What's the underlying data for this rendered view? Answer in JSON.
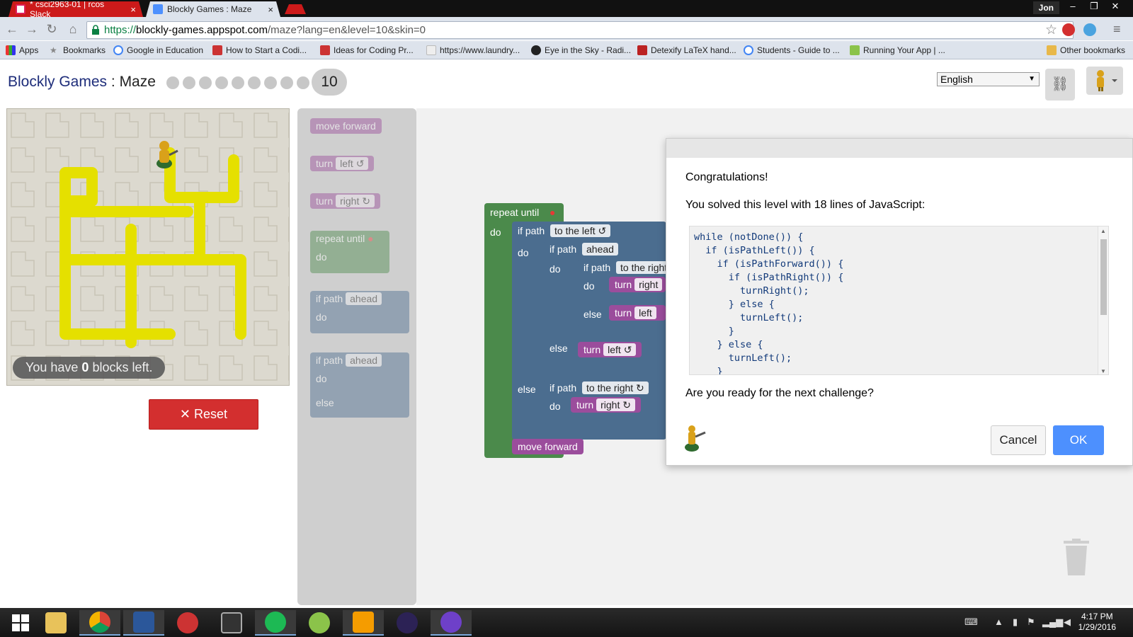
{
  "browser": {
    "tabs": [
      {
        "label": "* csci2963-01 | rcos Slack",
        "close": "×"
      },
      {
        "label": "Blockly Games : Maze",
        "close": "×"
      }
    ],
    "user": "Jon",
    "window_controls": {
      "minimize": "–",
      "restore": "❐",
      "close": "✕"
    },
    "url": {
      "scheme": "https://",
      "host": "blockly-games.appspot.com",
      "path": "/maze?lang=en&level=10&skin=0"
    },
    "bookmarks": [
      "Apps",
      "Bookmarks",
      "Google in Education",
      "How to Start a Codi...",
      "Ideas for Coding Pr...",
      "https://www.laundry...",
      "Eye in the Sky - Radi...",
      "Detexify LaTeX hand...",
      "Students - Guide to ...",
      "Running Your App | ..."
    ],
    "other_bookmarks": "Other bookmarks"
  },
  "app": {
    "title": "Blockly Games",
    "separator": " : ",
    "page": "Maze",
    "level": "10",
    "language": "English",
    "blocks_left_prefix": "You have ",
    "blocks_left_count": "0",
    "blocks_left_suffix": " blocks left.",
    "reset_label": "Reset",
    "reset_icon": "✕"
  },
  "toolbox": {
    "move_forward": "move forward",
    "turn": "turn",
    "left": "left ↺",
    "right": "right ↻",
    "repeat_until": "repeat until",
    "do": "do",
    "else": "else",
    "if_path": "if path",
    "ahead": "ahead"
  },
  "program": {
    "repeat_until": "repeat until",
    "do": "do",
    "else": "else",
    "if_path": "if path",
    "to_the_left": "to the left ↺",
    "ahead": "ahead",
    "to_the_right_cut": "to the right",
    "to_the_right": "to the right ↻",
    "turn": "turn",
    "right_cut": "right",
    "left_cut": "left",
    "left": "left ↺",
    "right": "right ↻",
    "move_forward": "move forward"
  },
  "dialog": {
    "congrats": "Congratulations!",
    "solved": "You solved this level with 18 lines of JavaScript:",
    "code": "while (notDone()) {\n  if (isPathLeft()) {\n    if (isPathForward()) {\n      if (isPathRight()) {\n        turnRight();\n      } else {\n        turnLeft();\n      }\n    } else {\n      turnLeft();\n    }",
    "ready": "Are you ready for the next challenge?",
    "cancel": "Cancel",
    "ok": "OK"
  },
  "taskbar": {
    "time": "4:17 PM",
    "date": "1/29/2016"
  },
  "colors": {
    "maze_path": "#e5e000",
    "accent_blue": "#4d90fe",
    "reset_red": "#d32f2f",
    "loop_green": "#4b8a4b",
    "if_blue": "#4b6d8f",
    "action_purple": "#9b4d9c"
  }
}
